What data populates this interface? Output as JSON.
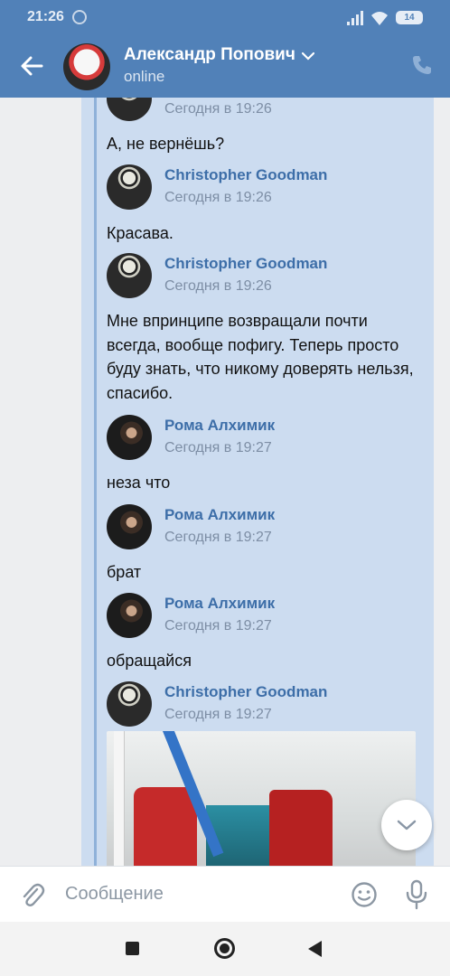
{
  "status_bar": {
    "time": "21:26",
    "battery": "14"
  },
  "header": {
    "name": "Александр Попович",
    "status": "online"
  },
  "messages": [
    {
      "author": "",
      "time": "Сегодня в 19:26",
      "avatar": "skeleton",
      "text": "А, не вернёшь?"
    },
    {
      "author": "Christopher Goodman",
      "time": "Сегодня в 19:26",
      "avatar": "skeleton",
      "text": "Красава."
    },
    {
      "author": "Christopher Goodman",
      "time": "Сегодня в 19:26",
      "avatar": "skeleton",
      "text": "Мне впринципе возвращали почти всегда, вообще пофигу. Теперь просто буду знать, что никому доверять нельзя, спасибо."
    },
    {
      "author": "Рома Алхимик",
      "time": "Сегодня в 19:27",
      "avatar": "portrait",
      "text": "неза что"
    },
    {
      "author": "Рома Алхимик",
      "time": "Сегодня в 19:27",
      "avatar": "portrait",
      "text": "брат"
    },
    {
      "author": "Рома Алхимик",
      "time": "Сегодня в 19:27",
      "avatar": "portrait",
      "text": "обращайся"
    },
    {
      "author": "Christopher Goodman",
      "time": "Сегодня в 19:27",
      "avatar": "skeleton",
      "text": ""
    }
  ],
  "composer": {
    "placeholder": "Сообщение"
  },
  "colors": {
    "header": "#5181b8",
    "bubble": "#ccdcf0",
    "author": "#3d6ea8",
    "time": "#7d8ea5"
  },
  "icons": [
    "back-arrow-icon",
    "chevron-down-icon",
    "phone-icon",
    "paperclip-icon",
    "smile-icon",
    "microphone-icon",
    "chevron-down-icon",
    "nav-recent-icon",
    "nav-home-icon",
    "nav-back-icon"
  ]
}
